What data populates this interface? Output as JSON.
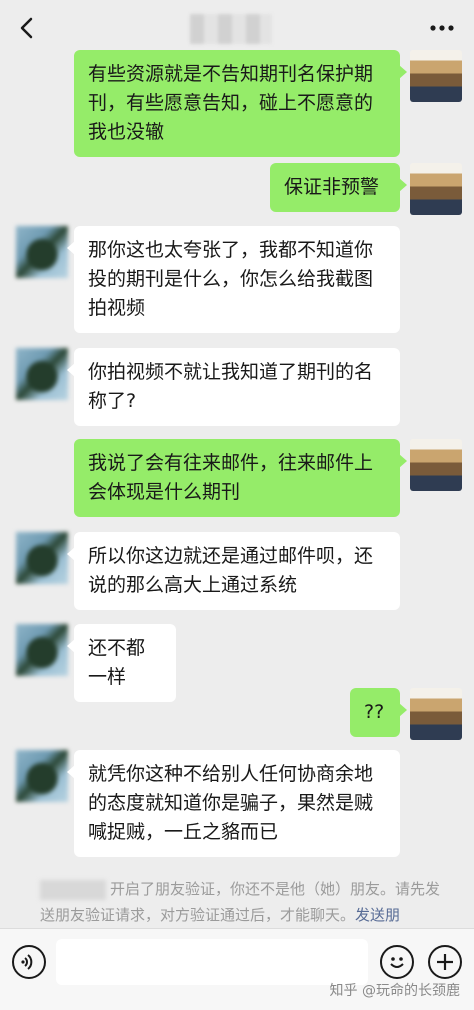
{
  "header": {
    "title": "",
    "back_icon": "chevron-left-icon",
    "more_icon": "more-dots-icon"
  },
  "messages": [
    {
      "side": "self",
      "text": "有些资源就是不告知期刊名保护期刊，有些愿意告知，碰上不愿意的我也没辙"
    },
    {
      "side": "self",
      "text": "保证非预警"
    },
    {
      "side": "other",
      "text": "那你这也太夸张了，我都不知道你投的期刊是什么，你怎么给我截图拍视频"
    },
    {
      "side": "other",
      "text": "你拍视频不就让我知道了期刊的名称了?"
    },
    {
      "side": "self",
      "text": "我说了会有往来邮件，往来邮件上会体现是什么期刊"
    },
    {
      "side": "other",
      "text": "所以你这边就还是通过邮件呗，还说的那么高大上通过系统"
    },
    {
      "side": "other",
      "text": "还不都一样"
    },
    {
      "side": "self",
      "text": "??"
    },
    {
      "side": "other",
      "text": "就凭你这种不给别人任何协商余地的态度就知道你是骗子，果然是贼喊捉贼，一丘之貉而已"
    }
  ],
  "notice": {
    "text": "开启了朋友验证，你还不是他（她）朋友。请先发送朋友验证请求，对方验证通过后，才能聊天。",
    "link": "发送朋"
  },
  "input": {
    "value": "",
    "placeholder": ""
  },
  "icons": {
    "voice": "voice-icon",
    "emoji": "emoji-icon",
    "plus": "plus-icon"
  },
  "watermark": "知乎 @玩命的长颈鹿",
  "colors": {
    "background": "#ededed",
    "self_bubble": "#95ec69",
    "other_bubble": "#ffffff",
    "link": "#576b95"
  }
}
